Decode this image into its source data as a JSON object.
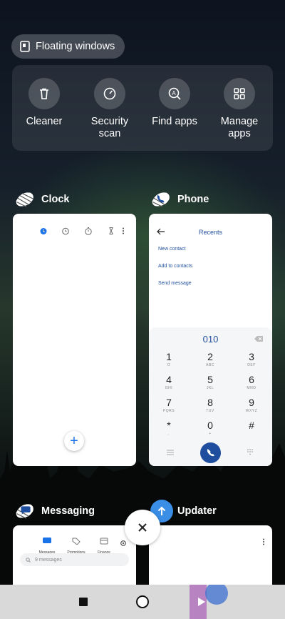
{
  "floating_windows": {
    "label": "Floating windows"
  },
  "shortcuts": [
    {
      "label": "Cleaner",
      "icon": "trash-icon"
    },
    {
      "label": "Security scan",
      "icon": "security-gauge-icon"
    },
    {
      "label": "Find apps",
      "icon": "search-apps-icon"
    },
    {
      "label": "Manage apps",
      "icon": "grid-icon"
    }
  ],
  "recent_apps": {
    "clock": {
      "name": "Clock",
      "fab_symbol": "+"
    },
    "phone": {
      "name": "Phone",
      "header": "Recents",
      "menu_items": [
        "New contact",
        "Add to contacts",
        "Send message"
      ],
      "dialed_number": "010",
      "keys": [
        {
          "digit": "1",
          "letters": "Ʊ"
        },
        {
          "digit": "2",
          "letters": "ABC"
        },
        {
          "digit": "3",
          "letters": "DEF"
        },
        {
          "digit": "4",
          "letters": "GHI"
        },
        {
          "digit": "5",
          "letters": "JKL"
        },
        {
          "digit": "6",
          "letters": "MNO"
        },
        {
          "digit": "7",
          "letters": "PQRS"
        },
        {
          "digit": "8",
          "letters": "TUV"
        },
        {
          "digit": "9",
          "letters": "WXYZ"
        },
        {
          "digit": "*",
          "letters": ","
        },
        {
          "digit": "0",
          "letters": "+"
        },
        {
          "digit": "#",
          "letters": ""
        }
      ]
    },
    "messaging": {
      "name": "Messaging",
      "tabs": [
        "Messages",
        "Promotions",
        "Finance"
      ],
      "search_placeholder": "9 messages"
    },
    "updater": {
      "name": "Updater"
    }
  },
  "colors": {
    "accent_blue": "#1a73e8",
    "dial_blue": "#1f4e9e"
  }
}
